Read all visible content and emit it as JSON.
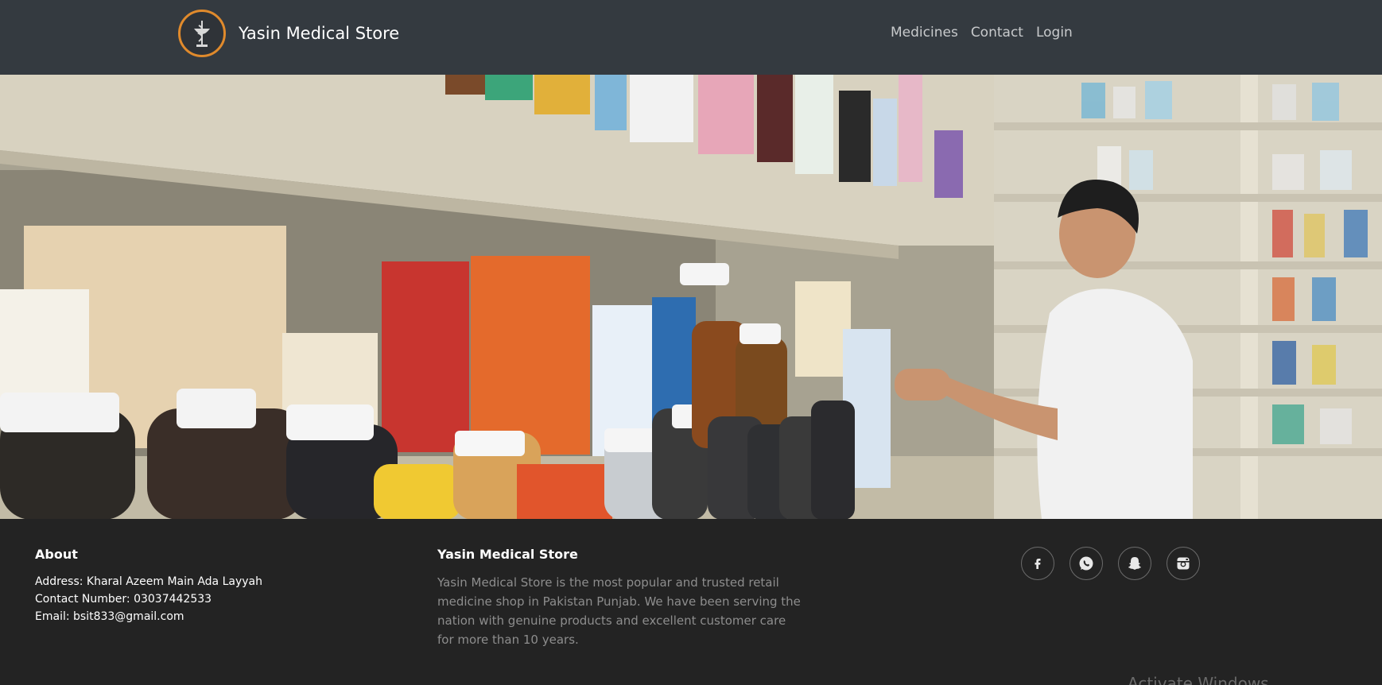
{
  "navbar": {
    "brand": "Yasin Medical Store",
    "links": [
      "Medicines",
      "Contact",
      "Login"
    ]
  },
  "footer": {
    "about": {
      "heading": "About",
      "address": "Address: Kharal Azeem Main Ada Layyah",
      "contact": "Contact Number: 03037442533",
      "email": "Email: bsit833@gmail.com"
    },
    "store": {
      "heading": "Yasin Medical Store",
      "description": "Yasin Medical Store is the most popular and trusted retail medicine shop in Pakistan Punjab. We have been serving the nation with genuine products and excellent customer care for more than 10 years."
    },
    "socials": [
      "facebook-icon",
      "whatsapp-icon",
      "snapchat-icon",
      "instagram-icon"
    ]
  },
  "overlay": {
    "watermark": "Activate Windows"
  },
  "colors": {
    "navbar": "#343a40",
    "footer": "#232323",
    "logo_ring": "#e08a2c",
    "muted_text": "#8d8d8d"
  }
}
